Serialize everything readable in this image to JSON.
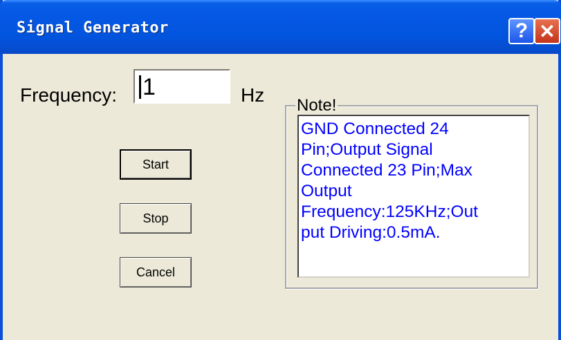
{
  "window": {
    "title": "Signal Generator"
  },
  "titlebar_buttons": {
    "help": "?",
    "close": "✕"
  },
  "frequency": {
    "label": "Frequency:",
    "value": "1",
    "unit": "Hz"
  },
  "buttons": {
    "start": "Start",
    "stop": "Stop",
    "cancel": "Cancel"
  },
  "note": {
    "title": "Note!",
    "lines": [
      "GND Connected 24",
      "Pin;Output Signal",
      "Connected 23 Pin;Max",
      "Output",
      "Frequency:125KHz;Out",
      "put Driving:0.5mA."
    ]
  },
  "colors": {
    "titlebar": "#0254dd",
    "dialog_bg": "#ece9d8",
    "note_text": "#0000ff",
    "close_button": "#c3351b"
  }
}
